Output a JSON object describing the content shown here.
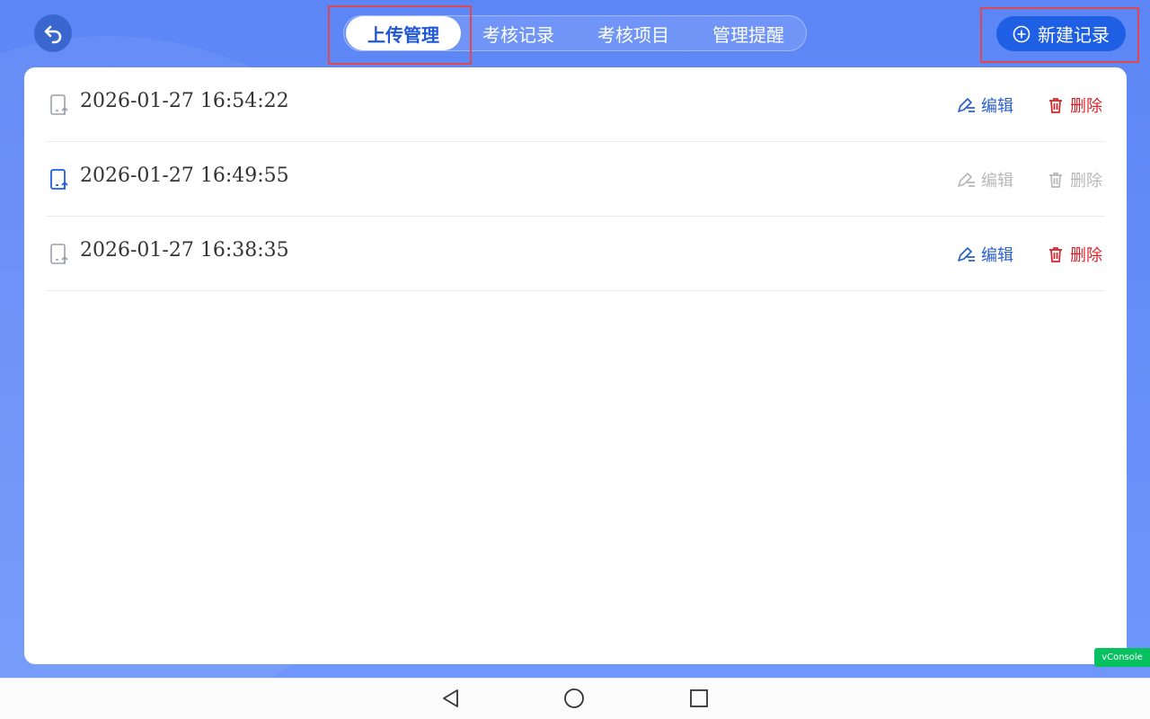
{
  "header": {
    "tabs": [
      {
        "label": "上传管理",
        "active": true
      },
      {
        "label": "考核记录",
        "active": false
      },
      {
        "label": "考核项目",
        "active": false
      },
      {
        "label": "管理提醒",
        "active": false
      }
    ],
    "new_button_label": "新建记录",
    "back_icon": "undo-arrow-icon",
    "new_icon": "plus-circle-icon"
  },
  "records": [
    {
      "time": "2026-01-27 16:54:22",
      "edit_label": "编辑",
      "delete_label": "删除",
      "enabled": true
    },
    {
      "time": "2026-01-27 16:49:55",
      "edit_label": "编辑",
      "delete_label": "删除",
      "enabled": false
    },
    {
      "time": "2026-01-27 16:38:35",
      "edit_label": "编辑",
      "delete_label": "删除",
      "enabled": true
    }
  ],
  "colors": {
    "accent": "#1f5fe3",
    "background": "#6f96fa",
    "delete": "#d8232a",
    "edit": "#2a5fcf",
    "disabled": "#b8b8b8",
    "highlight": "#e0484f"
  },
  "vconsole_label": "vConsole",
  "system_nav": [
    "back-triangle-icon",
    "home-circle-icon",
    "recents-square-icon"
  ]
}
